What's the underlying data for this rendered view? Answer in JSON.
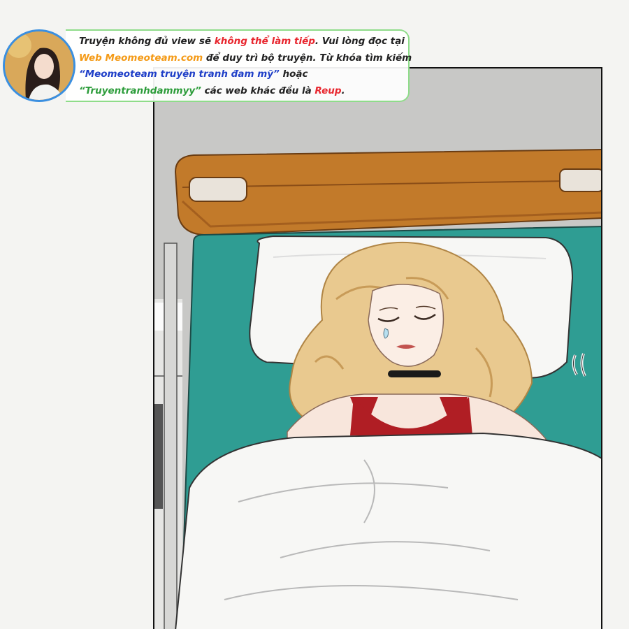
{
  "notice": {
    "line1_a": "Truyện không đủ view sẽ ",
    "line1_b": "không thể làm tiếp",
    "line1_c": ". Vui lòng đọc tại",
    "line2_a": "Web Meomeoteam.com",
    "line2_b": " để duy trì bộ truyện. Từ khóa tìm kiếm",
    "line3_a": "“Meomeoteam truyện tranh đam mỹ”",
    "line3_b": " hoặc",
    "line4_a": "“Truyentranhdammyy”",
    "line4_b": " các web khác đều là ",
    "line4_c": "Reup",
    "line4_d": "."
  },
  "colors": {
    "warning_red": "#e8262e",
    "site_orange": "#f49a16",
    "keyword_blue": "#1f3fc8",
    "keyword_green": "#2c9c3a",
    "sheet_teal": "#2f9d93",
    "headboard_wood": "#c27a2a"
  },
  "icons": {
    "avatar": "girl-avatar-icon",
    "sweat": "sweat-drop-icon",
    "tremble": "tremble-mark-icon"
  }
}
